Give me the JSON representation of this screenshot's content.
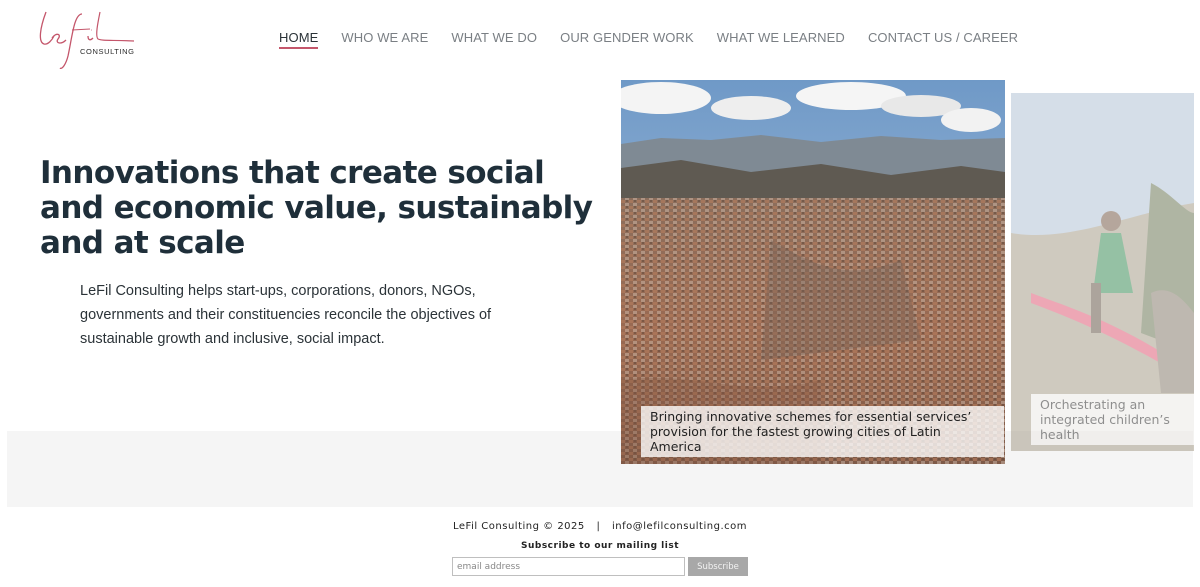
{
  "brand": {
    "logo_script": "Le fil",
    "logo_subtitle": "CONSULTING",
    "logo_color": "#c4566b"
  },
  "nav": {
    "items": [
      {
        "label": "HOME",
        "active": true
      },
      {
        "label": "WHO WE ARE",
        "active": false
      },
      {
        "label": "WHAT WE DO",
        "active": false
      },
      {
        "label": "OUR GENDER WORK",
        "active": false
      },
      {
        "label": "WHAT WE LEARNED",
        "active": false
      },
      {
        "label": "CONTACT US / CAREER",
        "active": false
      }
    ]
  },
  "hero": {
    "title": "Innovations that create social and economic value, sustainably and at scale",
    "text": "LeFil Consulting helps start-ups, corporations, donors, NGOs, governments and their constituencies reconcile the objectives of sustainable growth and inclusive, social impact."
  },
  "slides": [
    {
      "caption": "Bringing innovative schemes for essential services’ provision for the fastest growing cities of Latin America",
      "image": "city-aerial-photo"
    },
    {
      "caption": "Orchestrating an integrated children’s health",
      "image": "children-playing-photo"
    }
  ],
  "footer": {
    "copyright": "LeFil Consulting © 2025",
    "separator": "|",
    "email": "info@lefilconsulting.com",
    "subscribe_label": "Subscribe to our mailing list",
    "email_placeholder": "email address",
    "subscribe_button": "Subscribe"
  }
}
